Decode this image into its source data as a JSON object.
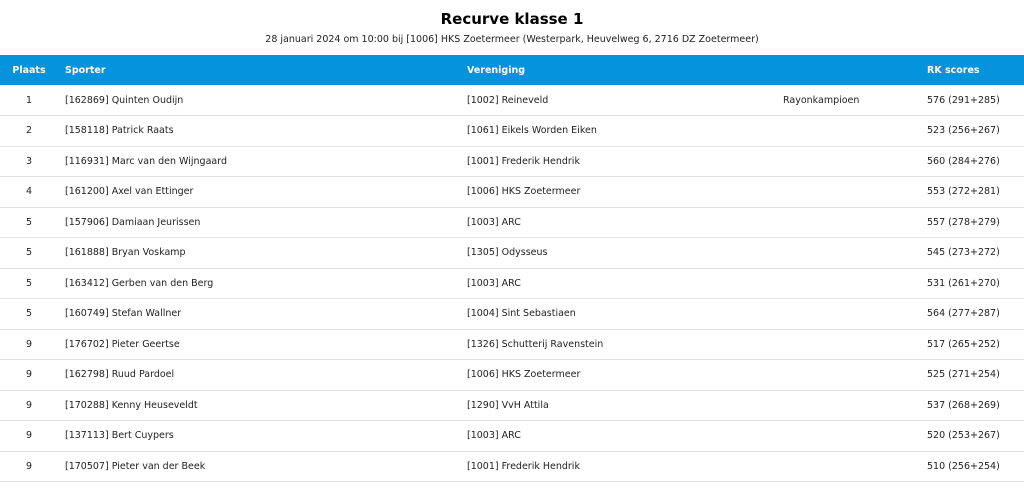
{
  "header": {
    "title": "Recurve klasse 1",
    "subtitle": "28 januari 2024 om 10:00 bij [1006] HKS Zoetermeer (Westerpark, Heuvelweg 6, 2716 DZ Zoetermeer)"
  },
  "table": {
    "columns": {
      "plaats": "Plaats",
      "sporter": "Sporter",
      "vereniging": "Vereniging",
      "titel": "",
      "scores": "RK scores"
    },
    "rows": [
      {
        "plaats": "1",
        "sporter": "[162869] Quinten Oudijn",
        "vereniging": "[1002] Reineveld",
        "titel": "Rayonkampioen",
        "scores": "576 (291+285)"
      },
      {
        "plaats": "2",
        "sporter": "[158118] Patrick Raats",
        "vereniging": "[1061] Eikels Worden Eiken",
        "titel": "",
        "scores": "523 (256+267)"
      },
      {
        "plaats": "3",
        "sporter": "[116931] Marc van den Wijngaard",
        "vereniging": "[1001] Frederik Hendrik",
        "titel": "",
        "scores": "560 (284+276)"
      },
      {
        "plaats": "4",
        "sporter": "[161200] Axel van Ettinger",
        "vereniging": "[1006] HKS Zoetermeer",
        "titel": "",
        "scores": "553 (272+281)"
      },
      {
        "plaats": "5",
        "sporter": "[157906] Damiaan Jeurissen",
        "vereniging": "[1003] ARC",
        "titel": "",
        "scores": "557 (278+279)"
      },
      {
        "plaats": "5",
        "sporter": "[161888] Bryan Voskamp",
        "vereniging": "[1305] Odysseus",
        "titel": "",
        "scores": "545 (273+272)"
      },
      {
        "plaats": "5",
        "sporter": "[163412] Gerben van den Berg",
        "vereniging": "[1003] ARC",
        "titel": "",
        "scores": "531 (261+270)"
      },
      {
        "plaats": "5",
        "sporter": "[160749] Stefan Wallner",
        "vereniging": "[1004] Sint Sebastiaen",
        "titel": "",
        "scores": "564 (277+287)"
      },
      {
        "plaats": "9",
        "sporter": "[176702] Pieter Geertse",
        "vereniging": "[1326] Schutterij Ravenstein",
        "titel": "",
        "scores": "517 (265+252)"
      },
      {
        "plaats": "9",
        "sporter": "[162798] Ruud Pardoel",
        "vereniging": "[1006] HKS Zoetermeer",
        "titel": "",
        "scores": "525 (271+254)"
      },
      {
        "plaats": "9",
        "sporter": "[170288] Kenny Heuseveldt",
        "vereniging": "[1290] VvH Attila",
        "titel": "",
        "scores": "537 (268+269)"
      },
      {
        "plaats": "9",
        "sporter": "[137113] Bert Cuypers",
        "vereniging": "[1003] ARC",
        "titel": "",
        "scores": "520 (253+267)"
      },
      {
        "plaats": "9",
        "sporter": "[170507] Pieter van der Beek",
        "vereniging": "[1001] Frederik Hendrik",
        "titel": "",
        "scores": "510 (256+254)"
      }
    ]
  },
  "colors": {
    "header_bg": "#0593de",
    "header_text": "#ffffff",
    "row_divider": "#e2e2e2"
  }
}
